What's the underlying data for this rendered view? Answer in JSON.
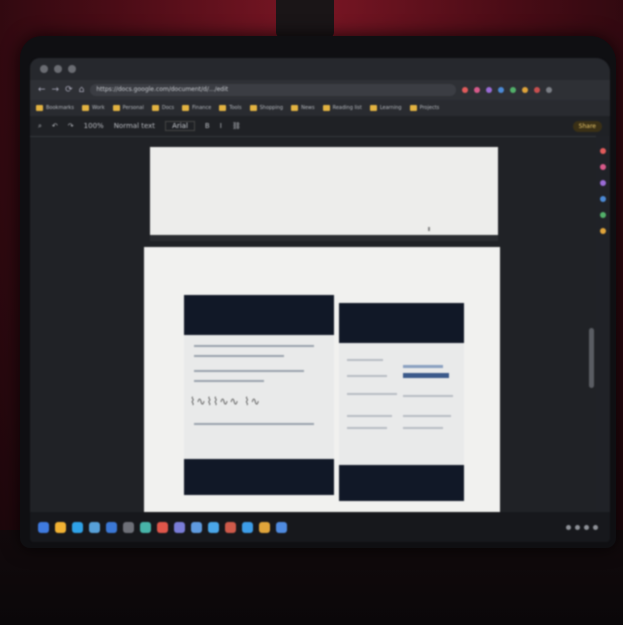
{
  "browser": {
    "tab_title": "",
    "url": "https://docs.google.com/document/d/.../edit",
    "nav": {
      "back": "←",
      "forward": "→",
      "reload": "⟳",
      "home": "⌂"
    },
    "extension_colors": [
      "#e25b5b",
      "#d85a8a",
      "#9a6bd6",
      "#4c8ad6",
      "#52b06a",
      "#e0a43a",
      "#c94f4f",
      "#7c7f86"
    ],
    "bookmarks": [
      {
        "label": "Bookmarks"
      },
      {
        "label": "Work"
      },
      {
        "label": "Personal"
      },
      {
        "label": "Docs"
      },
      {
        "label": "Finance"
      },
      {
        "label": "Tools"
      },
      {
        "label": "Shopping"
      },
      {
        "label": "News"
      },
      {
        "label": "Reading list"
      },
      {
        "label": "Learning"
      },
      {
        "label": "Projects"
      }
    ]
  },
  "docs_toolbar": {
    "zoom_label": "100%",
    "style_label": "Normal text",
    "font_label": "Arial",
    "share_label": "Share"
  },
  "taskbar": {
    "app_icon_colors": [
      "#3f7be0",
      "#f2b233",
      "#2fa2e8",
      "#57a0d8",
      "#3b78d6",
      "#6e7078",
      "#47b4a8",
      "#e0564a",
      "#7a7dd8",
      "#5f9be0",
      "#4aa6e8",
      "#cf5a4a",
      "#3d9de8",
      "#e0a43a",
      "#4f8be0"
    ],
    "clock": ""
  }
}
